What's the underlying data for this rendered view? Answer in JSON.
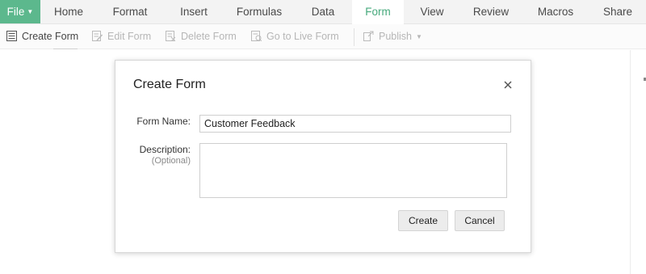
{
  "menubar": {
    "file": "File",
    "items": [
      "Home",
      "Format",
      "Insert",
      "Formulas",
      "Data",
      "Form",
      "View",
      "Review",
      "Macros",
      "Share"
    ],
    "active": "Form"
  },
  "toolbar": {
    "create_form": "Create Form",
    "edit_form": "Edit Form",
    "delete_form": "Delete Form",
    "live_form": "Go to Live Form",
    "publish": "Publish"
  },
  "dialog": {
    "title": "Create Form",
    "form_name_label": "Form Name:",
    "form_name_value": "Customer Feedback",
    "description_label": "Description:",
    "description_hint": "(Optional)",
    "description_value": "",
    "create_button": "Create",
    "cancel_button": "Cancel"
  },
  "colors": {
    "accent": "#5cb88d",
    "active_tab_text": "#46a97c"
  }
}
